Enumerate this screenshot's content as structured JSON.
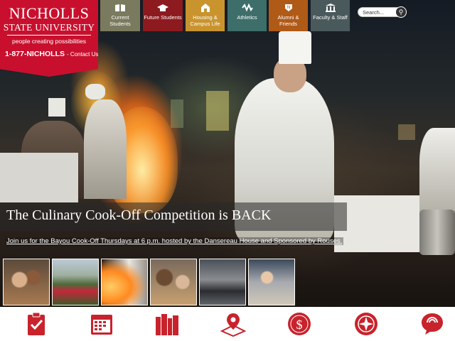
{
  "logo": {
    "line1": "NICHOLLS",
    "line2": "STATE UNIVERSITY",
    "tagline": "people creating possibilities",
    "phone": "1-877-NICHOLLS",
    "contact": "- Contact Us"
  },
  "nav": [
    {
      "label": "Current Students",
      "color": "#7a7a5e",
      "icon": "book-icon"
    },
    {
      "label": "Future Students",
      "color": "#8c1a1f",
      "icon": "graduation-cap-icon"
    },
    {
      "label": "Housing & Campus Life",
      "color": "#c9942e",
      "icon": "house-icon"
    },
    {
      "label": "Athletics",
      "color": "#3d6e6a",
      "icon": "athletics-logo-icon"
    },
    {
      "label": "Alumni & Friends",
      "color": "#b05a18",
      "icon": "alumni-crest-icon"
    },
    {
      "label": "Faculty & Staff",
      "color": "#4a5a5c",
      "icon": "building-icon"
    }
  ],
  "search": {
    "placeholder": "Search..."
  },
  "hero": {
    "headline": "The Culinary Cook-Off Competition is BACK",
    "subline": "Join us for the Bayou Cook-Off Thursdays at 6 p.m. hosted by the Dansereau House and Sponsored by Rouses."
  },
  "thumbnails": [
    "students-photo",
    "campus-garden-photo",
    "culinary-chef-photo",
    "students-group-photo",
    "computer-lab-photo",
    "cooking-class-photo"
  ],
  "quicklinks": [
    "clipboard-icon",
    "calendar-icon",
    "library-books-icon",
    "map-pin-icon",
    "dollar-seal-icon",
    "compass-icon",
    "speech-bubble-icon"
  ],
  "colors": {
    "brand_red": "#c8102e",
    "icon_red": "#c8232c"
  }
}
